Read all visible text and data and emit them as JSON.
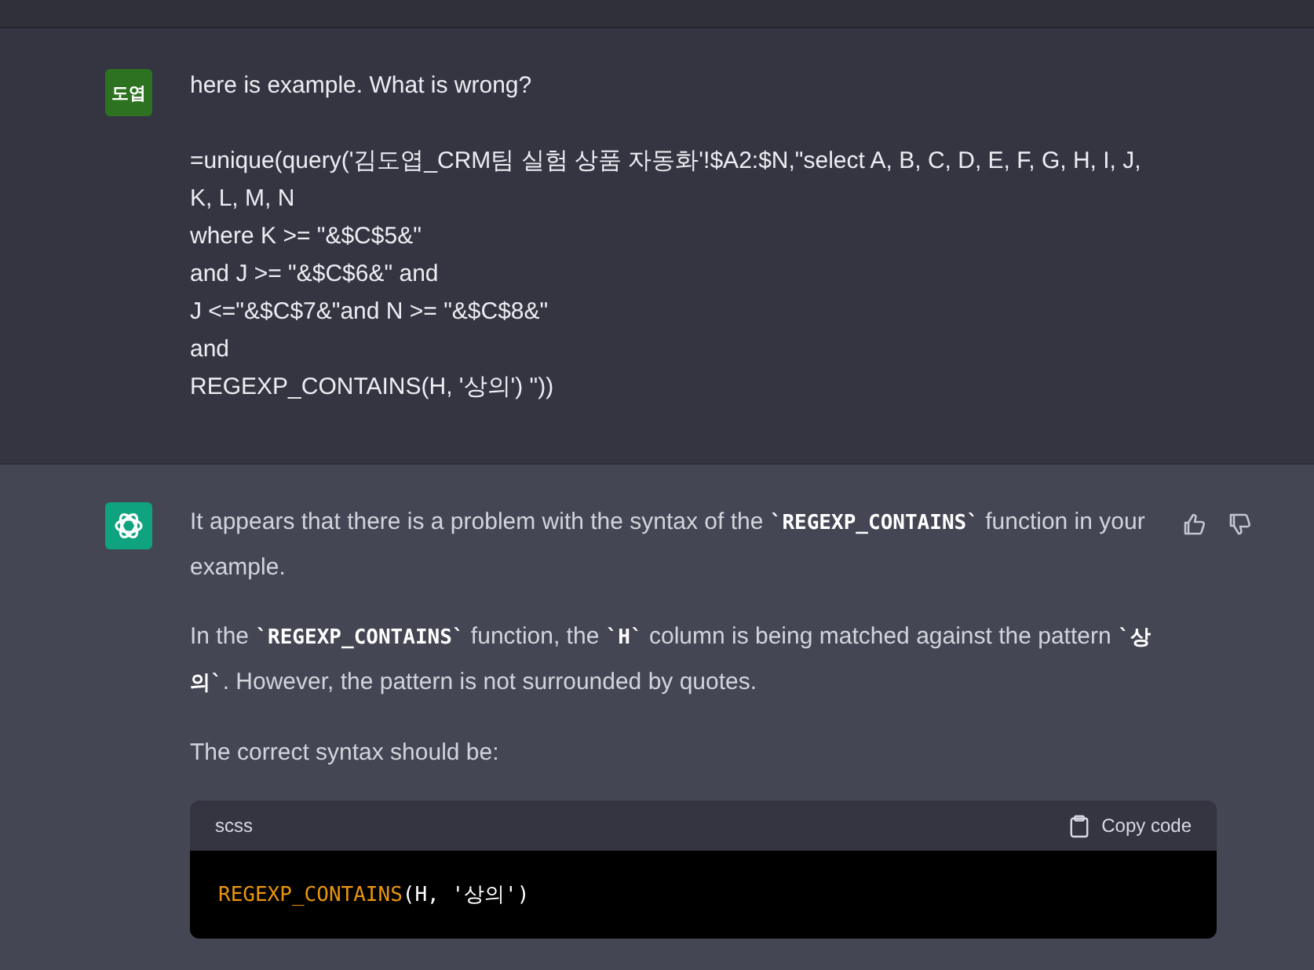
{
  "user_message": {
    "avatar": "도엽",
    "paragraphs": [
      [
        "here is example. What is wrong?"
      ],
      [
        "=unique(query('김도엽_CRM팀 실험 상품 자동화'!$A2:$N,\"select A, B, C, D, E, F, G, H, I, J,",
        "K, L, M, N",
        "where K >= \"&$C$5&\"",
        "and J >= \"&$C$6&\" and",
        "J <=\"&$C$7&\"and N >= \"&$C$8&\"",
        "and",
        "REGEXP_CONTAINS(H, '상의') \"))"
      ]
    ]
  },
  "assistant_message": {
    "paragraphs": [
      "It appears that there is a problem with the syntax of the **`REGEXP_CONTAINS`** function in your example.",
      "In the **`REGEXP_CONTAINS`** function, the **`H`** column is being matched against the pattern **`상의`**. However, the pattern is not surrounded by quotes.",
      "The correct syntax should be:"
    ],
    "code_block": {
      "language": "scss",
      "copy_label": "Copy code",
      "tokens": [
        {
          "text": "REGEXP_CONTAINS",
          "kind": "function"
        },
        {
          "text": "(H, '상의')",
          "kind": "plain"
        }
      ]
    }
  }
}
